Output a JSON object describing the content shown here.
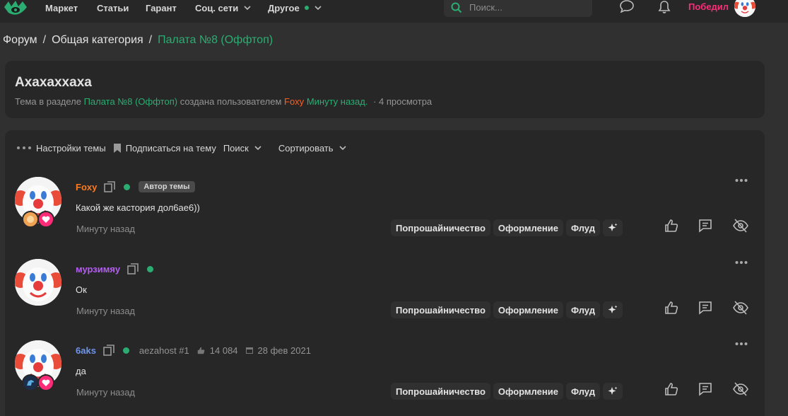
{
  "header": {
    "nav": [
      "Маркет",
      "Статьи",
      "Гарант",
      "Соц. сети",
      "Другое"
    ],
    "search_placeholder": "Поиск...",
    "username": "Победил"
  },
  "breadcrumb": {
    "items": [
      "Форум",
      "Общая категория"
    ],
    "current": "Палата №8 (Оффтоп)"
  },
  "thread": {
    "title": "Ахахаххаха",
    "sub_prefix": "Тема в разделе",
    "section": "Палата №8 (Оффтоп)",
    "created_by": "создана пользователем",
    "author": "Foxy",
    "time": "Минуту назад.",
    "views": "· 4 просмотра"
  },
  "toolbar": {
    "settings": "Настройки темы",
    "subscribe": "Подписаться на тему",
    "search": "Поиск",
    "sort": "Сортировать"
  },
  "reactions": [
    "Попрошайничество",
    "Оформление",
    "Флуд"
  ],
  "posts": [
    {
      "username": "Foxy",
      "name_color": "#ff7a1f",
      "author_tag": "Автор темы",
      "message": "Какой же кастория дол6ае6))",
      "time": "Минуту назад"
    },
    {
      "username": "мурзимяу",
      "name_color": "#b65df5",
      "message": "Ок",
      "time": "Минуту назад"
    },
    {
      "username": "6aks",
      "name_color": "#6f95ea",
      "host": "aezahost #1",
      "likes": "14 084",
      "joined": "28 фев 2021",
      "message": "да",
      "time": "Минуту назад"
    }
  ],
  "colors": {
    "accent": "#2bad72",
    "username_top": "#fe2b79",
    "background": "#303030",
    "card": "#272727"
  }
}
